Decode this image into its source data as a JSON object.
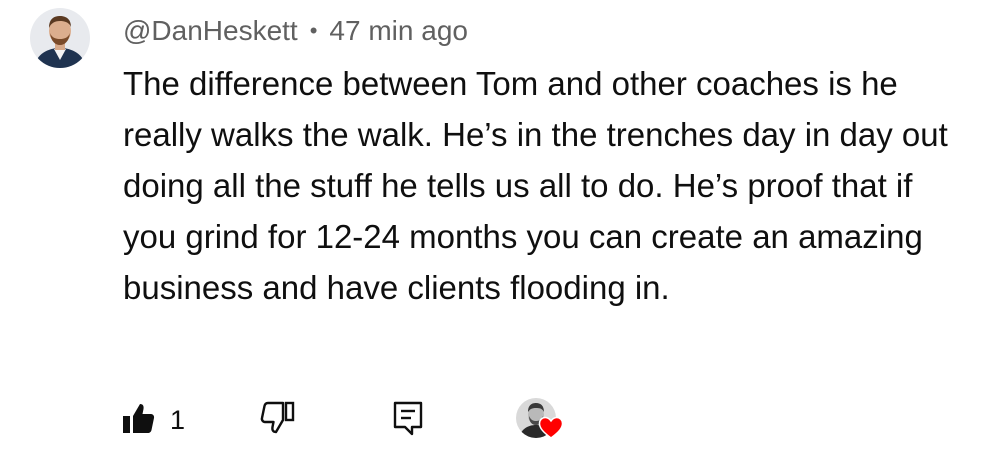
{
  "comment": {
    "author": "@DanHeskett",
    "separator": "•",
    "timestamp": "47 min ago",
    "text": "The difference between Tom and other coaches is he really walks the walk. He’s in the trenches day in day out doing all the stuff he tells us all to do. He’s proof that if you grind for 12-24 months you can create an amazing business and have clients flooding in.",
    "like_count": "1"
  },
  "icons": {
    "like": "thumbs-up-filled-icon",
    "dislike": "thumbs-down-outline-icon",
    "reply": "reply-comment-icon",
    "creator_heart": "heart-icon"
  },
  "colors": {
    "meta_text": "#606060",
    "body_text": "#0f0f0f",
    "heart": "#ff0000"
  }
}
